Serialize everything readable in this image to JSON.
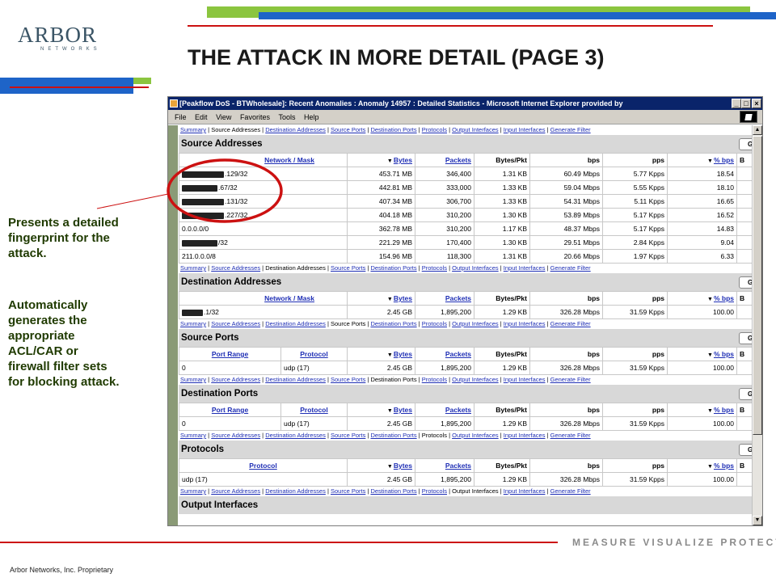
{
  "colors": {
    "green": "#8bc53f",
    "blue": "#1e64c8",
    "red": "#cc1111",
    "title_bar": "#0a246a",
    "link": "#1f2fb5",
    "note_text": "#1f3a00"
  },
  "logo": {
    "main": "ARBOR",
    "sub": "NETWORKS"
  },
  "slide_title": "THE ATTACK IN MORE DETAIL (PAGE 3)",
  "notes": {
    "fingerprint": [
      "Presents a detailed",
      "fingerprint for the",
      "attack."
    ],
    "acl": [
      "Automatically",
      "generates the",
      "appropriate",
      "ACL/CAR or",
      "firewall filter sets",
      "for blocking attack."
    ]
  },
  "tagline": "MEASURE VISUALIZE PROTECT",
  "footer": "Arbor Networks, Inc. Proprietary",
  "browser": {
    "title": "[Peakflow DoS - BTWholesale]: Recent Anomalies : Anomaly 14957 : Detailed Statistics - Microsoft Internet Explorer provided by",
    "menu": [
      "File",
      "Edit",
      "View",
      "Favorites",
      "Tools",
      "Help"
    ],
    "window_buttons": {
      "minimize": "_",
      "maximize": "□",
      "close": "×"
    },
    "scroll_arrows": {
      "up": "▲",
      "down": "▼"
    }
  },
  "nav_links": [
    "Summary",
    "Source Addresses",
    "Destination Addresses",
    "Source Ports",
    "Destination Ports",
    "Protocols",
    "Output Interfaces",
    "Input Interfaces",
    "Generate Filter"
  ],
  "go_label": "G",
  "clipped_col": "B",
  "sections": {
    "source_addresses": {
      "title": "Source Addresses",
      "headers": [
        "Network / Mask",
        "Bytes",
        "Packets",
        "Bytes/Pkt",
        "bps",
        "pps",
        "% bps"
      ],
      "rows": [
        [
          ".129/32",
          "453.71 MB",
          "346,400",
          "1.31 KB",
          "60.49 Mbps",
          "5.77 Kpps",
          "18.54"
        ],
        [
          ".67/32",
          "442.81 MB",
          "333,000",
          "1.33 KB",
          "59.04 Mbps",
          "5.55 Kpps",
          "18.10"
        ],
        [
          ".131/32",
          "407.34 MB",
          "306,700",
          "1.33 KB",
          "54.31 Mbps",
          "5.11 Kpps",
          "16.65"
        ],
        [
          ".227/32",
          "404.18 MB",
          "310,200",
          "1.30 KB",
          "53.89 Mbps",
          "5.17 Kpps",
          "16.52"
        ],
        [
          "0.0.0.0/0",
          "362.78 MB",
          "310,200",
          "1.17 KB",
          "48.37 Mbps",
          "5.17 Kpps",
          "14.83"
        ],
        [
          "/32",
          "221.29 MB",
          "170,400",
          "1.30 KB",
          "29.51 Mbps",
          "2.84 Kpps",
          "9.04"
        ],
        [
          "211.0.0.0/8",
          "154.96 MB",
          "118,300",
          "1.31 KB",
          "20.66 Mbps",
          "1.97 Kpps",
          "6.33"
        ]
      ]
    },
    "destination_addresses": {
      "title": "Destination Addresses",
      "headers": [
        "Network / Mask",
        "Bytes",
        "Packets",
        "Bytes/Pkt",
        "bps",
        "pps",
        "% bps"
      ],
      "rows": [
        [
          ".1/32",
          "2.45 GB",
          "1,895,200",
          "1.29 KB",
          "326.28 Mbps",
          "31.59 Kpps",
          "100.00"
        ]
      ]
    },
    "source_ports": {
      "title": "Source Ports",
      "headers": [
        "Port Range",
        "Protocol",
        "Bytes",
        "Packets",
        "Bytes/Pkt",
        "bps",
        "pps",
        "% bps"
      ],
      "rows": [
        [
          "0",
          "udp (17)",
          "2.45 GB",
          "1,895,200",
          "1.29 KB",
          "326.28 Mbps",
          "31.59 Kpps",
          "100.00"
        ]
      ]
    },
    "destination_ports": {
      "title": "Destination Ports",
      "headers": [
        "Port Range",
        "Protocol",
        "Bytes",
        "Packets",
        "Bytes/Pkt",
        "bps",
        "pps",
        "% bps"
      ],
      "rows": [
        [
          "0",
          "udp (17)",
          "2.45 GB",
          "1,895,200",
          "1.29 KB",
          "326.28 Mbps",
          "31.59 Kpps",
          "100.00"
        ]
      ]
    },
    "protocols": {
      "title": "Protocols",
      "headers": [
        "Protocol",
        "Bytes",
        "Packets",
        "Bytes/Pkt",
        "bps",
        "pps",
        "% bps"
      ],
      "rows": [
        [
          "udp (17)",
          "2.45 GB",
          "1,895,200",
          "1.29 KB",
          "326.28 Mbps",
          "31.59 Kpps",
          "100.00"
        ]
      ]
    },
    "output_interfaces": {
      "title": "Output Interfaces"
    }
  }
}
